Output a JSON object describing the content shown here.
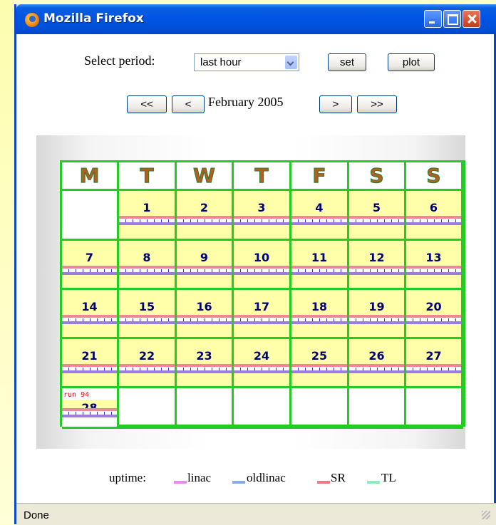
{
  "window": {
    "title": "Mozilla Firefox"
  },
  "controls": {
    "select_label": "Select period:",
    "period_value": "last hour",
    "set_label": "set",
    "plot_label": "plot"
  },
  "nav": {
    "first_label": "<<",
    "prev_label": "<",
    "month_label": "February 2005",
    "next_label": ">",
    "last_label": ">>"
  },
  "calendar": {
    "weekdays": [
      "M",
      "T",
      "W",
      "T",
      "F",
      "S",
      "S"
    ],
    "days": [
      "1",
      "2",
      "3",
      "4",
      "5",
      "6",
      "7",
      "8",
      "9",
      "10",
      "11",
      "12",
      "13",
      "14",
      "15",
      "16",
      "17",
      "18",
      "19",
      "20",
      "21",
      "22",
      "23",
      "24",
      "25",
      "26",
      "27",
      "28"
    ],
    "run_note": "run 94",
    "colors": {
      "grid": "#22cc22",
      "cell": "#ffffaa",
      "number": "#000077"
    }
  },
  "legend": {
    "label": "uptime:",
    "items": [
      {
        "name": "linac",
        "color": "#ee88ee"
      },
      {
        "name": "oldlinac",
        "color": "#88aaee"
      },
      {
        "name": "SR",
        "color": "#ee7788"
      },
      {
        "name": "TL",
        "color": "#88eebb"
      }
    ]
  },
  "status": {
    "text": "Done"
  }
}
